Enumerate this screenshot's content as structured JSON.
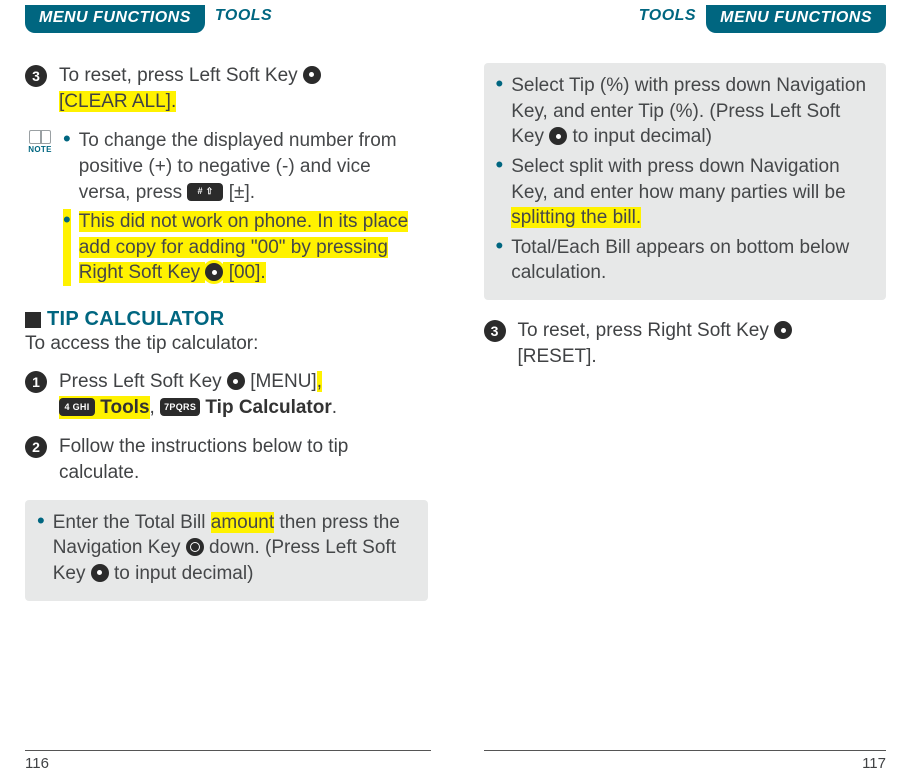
{
  "header": {
    "menu_functions": "MENU FUNCTIONS",
    "tools": "TOOLS"
  },
  "left": {
    "step3_a": "To reset, press Left Soft Key ",
    "step3_b": "[CLEAR ALL].",
    "note_label": "NOTE",
    "note1_a": "To change the displayed number from positive (+) to negative (-) and vice versa, press ",
    "note1_b": " [±].",
    "note2_a": "This did not work on phone. In its place add copy for adding \"00\" by pressing Right Soft Key ",
    "note2_b": " [00].",
    "tip_heading": "TIP CALCULATOR",
    "tip_sub": "To access the tip calculator:",
    "step1_a": "Press Left Soft Key ",
    "step1_b": " [MENU]",
    "step1_c": ", ",
    "step1_tools": " Tools",
    "step1_d": ", ",
    "step1_tipcalc": " Tip Calculator",
    "step1_e": ".",
    "key4": "4 GHI",
    "key7": "7PQRS",
    "keyhash": "# ⇧",
    "step2": "Follow the instructions below to tip calculate.",
    "box1_a": "Enter the Total Bill ",
    "box1_amount": "amount",
    "box1_b": " then press the Navigation Key ",
    "box1_c": " down. (Press Left Soft Key ",
    "box1_d": " to input decimal)",
    "page_num": "116"
  },
  "right": {
    "box1_a": "Select Tip (%) with press down Navigation Key, and enter Tip (%). (Press Left Soft Key ",
    "box1_b": " to input decimal)",
    "box2_a": "Select split with press down Navigation Key, and enter how many parties will be ",
    "box2_split": "splitting the bill.",
    "box3": "Total/Each Bill appears on bottom below calculation.",
    "step3_a": "To reset, press Right Soft Key ",
    "step3_b": "[RESET].",
    "page_num": "117"
  }
}
